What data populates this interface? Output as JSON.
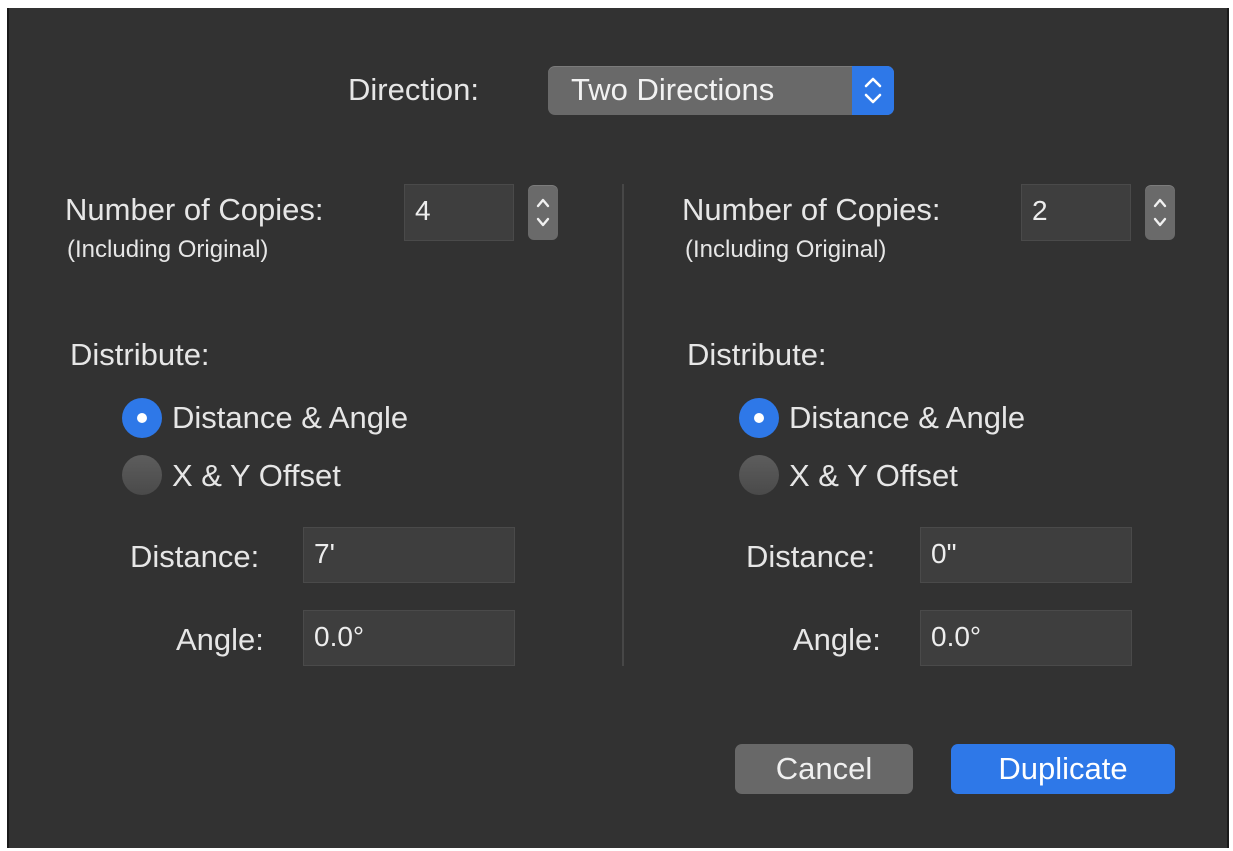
{
  "direction": {
    "label": "Direction:",
    "value": "Two Directions"
  },
  "left": {
    "copies_label": "Number of Copies:",
    "copies_sublabel": "(Including Original)",
    "copies_value": "4",
    "distribute_label": "Distribute:",
    "option_distance_angle": "Distance & Angle",
    "option_xy_offset": "X & Y Offset",
    "selected_option": "Distance & Angle",
    "distance_label": "Distance:",
    "distance_value": "7'",
    "angle_label": "Angle:",
    "angle_value": "0.0°"
  },
  "right": {
    "copies_label": "Number of Copies:",
    "copies_sublabel": "(Including Original)",
    "copies_value": "2",
    "distribute_label": "Distribute:",
    "option_distance_angle": "Distance & Angle",
    "option_xy_offset": "X & Y Offset",
    "selected_option": "Distance & Angle",
    "distance_label": "Distance:",
    "distance_value": "0\"",
    "angle_label": "Angle:",
    "angle_value": "0.0°"
  },
  "buttons": {
    "cancel": "Cancel",
    "duplicate": "Duplicate"
  },
  "colors": {
    "background": "#323232",
    "accent": "#2e78e8",
    "field": "#3e3e3e"
  }
}
